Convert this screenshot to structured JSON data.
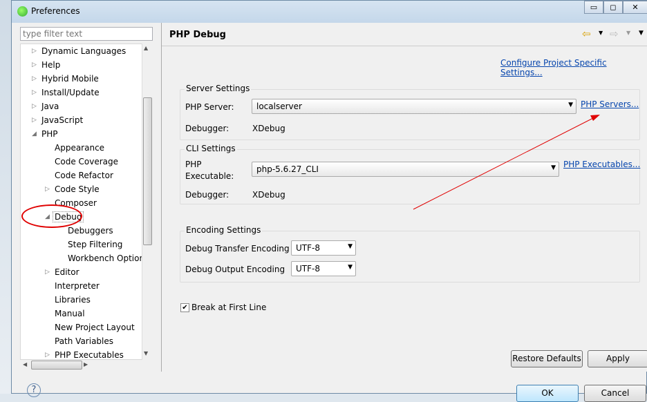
{
  "window": {
    "title": "Preferences",
    "minimize": "▭",
    "maximize": "◻",
    "close": "✕"
  },
  "filter": {
    "placeholder": "type filter text"
  },
  "tree": [
    {
      "label": "Dynamic Languages",
      "level": 0,
      "arrow": "right"
    },
    {
      "label": "Help",
      "level": 0,
      "arrow": "right"
    },
    {
      "label": "Hybrid Mobile",
      "level": 0,
      "arrow": "right"
    },
    {
      "label": "Install/Update",
      "level": 0,
      "arrow": "right"
    },
    {
      "label": "Java",
      "level": 0,
      "arrow": "right"
    },
    {
      "label": "JavaScript",
      "level": 0,
      "arrow": "right"
    },
    {
      "label": "PHP",
      "level": 0,
      "arrow": "down"
    },
    {
      "label": "Appearance",
      "level": 1,
      "arrow": ""
    },
    {
      "label": "Code Coverage",
      "level": 1,
      "arrow": ""
    },
    {
      "label": "Code Refactor",
      "level": 1,
      "arrow": ""
    },
    {
      "label": "Code Style",
      "level": 1,
      "arrow": "right"
    },
    {
      "label": "Composer",
      "level": 1,
      "arrow": ""
    },
    {
      "label": "Debug",
      "level": 1,
      "arrow": "down",
      "selected": true
    },
    {
      "label": "Debuggers",
      "level": 2,
      "arrow": ""
    },
    {
      "label": "Step Filtering",
      "level": 2,
      "arrow": ""
    },
    {
      "label": "Workbench Options",
      "level": 2,
      "arrow": ""
    },
    {
      "label": "Editor",
      "level": 1,
      "arrow": "right"
    },
    {
      "label": "Interpreter",
      "level": 1,
      "arrow": ""
    },
    {
      "label": "Libraries",
      "level": 1,
      "arrow": ""
    },
    {
      "label": "Manual",
      "level": 1,
      "arrow": ""
    },
    {
      "label": "New Project Layout",
      "level": 1,
      "arrow": ""
    },
    {
      "label": "Path Variables",
      "level": 1,
      "arrow": ""
    },
    {
      "label": "PHP Executables",
      "level": 1,
      "arrow": "right"
    }
  ],
  "page": {
    "title": "PHP Debug",
    "configure_link": "Configure Project Specific Settings...",
    "server": {
      "group": "Server Settings",
      "php_server_label": "PHP Server:",
      "php_server_value": "localserver",
      "servers_link": "PHP Servers...",
      "debugger_label": "Debugger:",
      "debugger_value": "XDebug"
    },
    "cli": {
      "group": "CLI Settings",
      "exe_label_1": "PHP",
      "exe_label_2": "Executable:",
      "exe_value": "php-5.6.27_CLI",
      "exe_link": "PHP Executables...",
      "debugger_label": "Debugger:",
      "debugger_value": "XDebug"
    },
    "encoding": {
      "group": "Encoding Settings",
      "transfer_label": "Debug Transfer Encoding",
      "transfer_value": "UTF-8",
      "output_label": "Debug Output Encoding",
      "output_value": "UTF-8"
    },
    "break_first_line": {
      "label": "Break at First Line",
      "checked": true
    },
    "restore_defaults": "Restore Defaults",
    "apply": "Apply"
  },
  "footer": {
    "ok": "OK",
    "cancel": "Cancel",
    "help": "?"
  },
  "annotation_color": "#e00000"
}
